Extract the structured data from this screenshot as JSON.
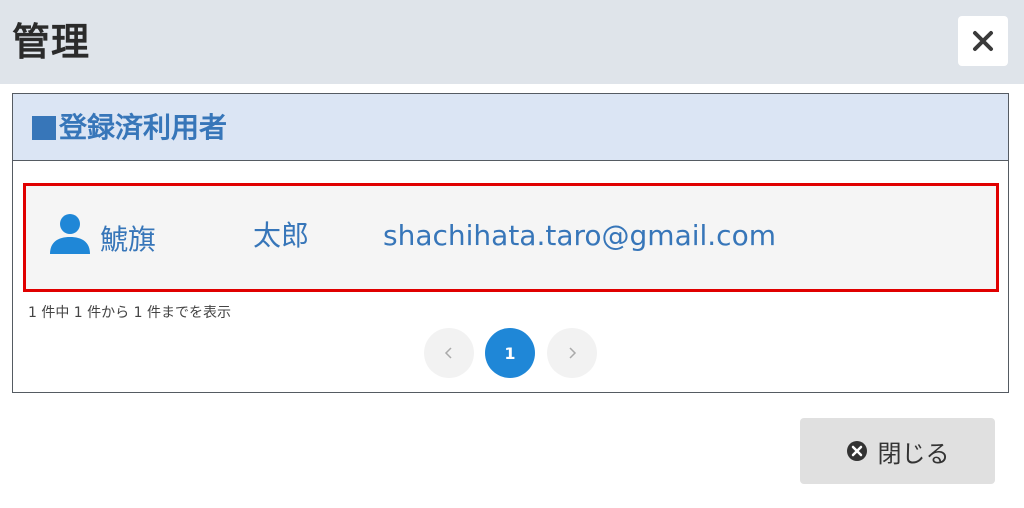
{
  "header": {
    "title": "管理",
    "close_icon": "close-icon"
  },
  "panel": {
    "heading": "登録済利用者",
    "heading_marker_color": "#3776b9"
  },
  "users": [
    {
      "icon": "user-icon",
      "last_name": "鯱旗",
      "first_name": "太郎",
      "email": "shachihata.taro@gmail.com"
    }
  ],
  "pagination": {
    "summary": "1 件中 1 件から 1 件までを表示",
    "prev_icon": "chevron-left-icon",
    "current_page": "1",
    "next_icon": "chevron-right-icon"
  },
  "footer": {
    "close_label": "閉じる",
    "close_icon": "circle-x-icon"
  },
  "colors": {
    "accent": "#1f87d7",
    "link_blue": "#3776b9",
    "highlight_border": "#e00000",
    "header_bg": "#dfe4ea"
  }
}
